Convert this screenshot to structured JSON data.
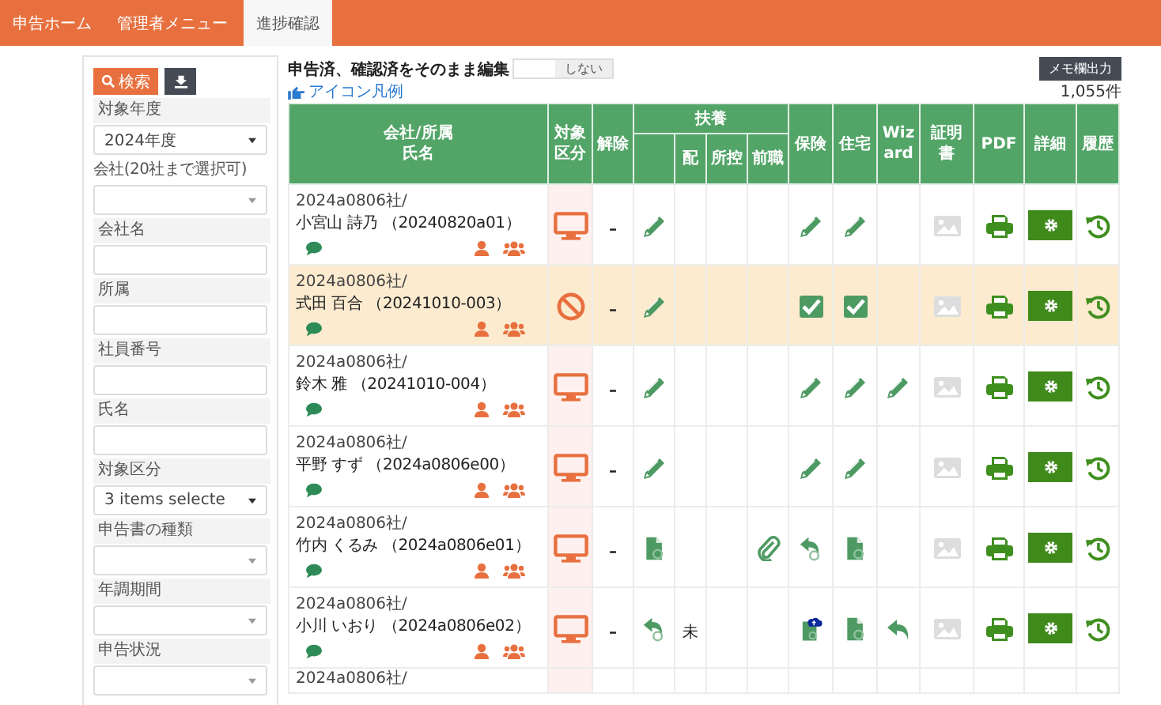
{
  "nav": {
    "tabs": [
      {
        "label": "申告ホーム",
        "selected": false
      },
      {
        "label": "管理者メニュー",
        "selected": false
      },
      {
        "label": "進捗確認",
        "selected": true
      }
    ]
  },
  "sidebar": {
    "search_button": "検索",
    "filters": [
      {
        "label": "対象年度",
        "kind": "select",
        "value": "2024年度"
      },
      {
        "label": "会社(20社まで選択可)",
        "kind": "select",
        "small": true
      },
      {
        "label": "会社名",
        "kind": "input"
      },
      {
        "label": "所属",
        "kind": "input"
      },
      {
        "label": "社員番号",
        "kind": "input"
      },
      {
        "label": "氏名",
        "kind": "input"
      },
      {
        "label": "対象区分",
        "kind": "select",
        "value": "3 items selecte"
      },
      {
        "label": "申告書の種類",
        "kind": "select"
      },
      {
        "label": "年調期間",
        "kind": "select"
      },
      {
        "label": "申告状況",
        "kind": "select"
      }
    ]
  },
  "toolbar": {
    "edit_label": "申告済、確認済をそのまま編集",
    "edit_toggle": {
      "label": "しない",
      "on": false
    },
    "memo_button": "メモ欄出力",
    "legend_link": "アイコン凡例",
    "count": "1,055件"
  },
  "table": {
    "columns": [
      "会社/所属",
      "氏名",
      "対象区分",
      "解除",
      "扶養",
      "配",
      "所控",
      "前職",
      "保険",
      "住宅",
      "Wizard",
      "証明書",
      "PDF",
      "詳細",
      "履歴"
    ],
    "rows": [
      {
        "company": "2024a0806社/",
        "name": "小宮山 詩乃 （20240820a01）",
        "highlighted": false,
        "target": {
          "kind": "pc"
        },
        "release": "–",
        "cells": [
          {
            "kind": "edit"
          },
          {
            "kind": "blank"
          },
          {
            "kind": "blank"
          },
          {
            "kind": "blank"
          },
          {
            "kind": "edit"
          },
          {
            "kind": "edit"
          },
          {
            "kind": "blank"
          }
        ]
      },
      {
        "company": "2024a0806社/",
        "name": "式田 百合 （20241010-003）",
        "highlighted": true,
        "target": {
          "kind": "excluded"
        },
        "release": "–",
        "cells": [
          {
            "kind": "edit"
          },
          {
            "kind": "blank"
          },
          {
            "kind": "blank"
          },
          {
            "kind": "blank"
          },
          {
            "kind": "check"
          },
          {
            "kind": "check"
          },
          {
            "kind": "blank"
          }
        ]
      },
      {
        "company": "2024a0806社/",
        "name": "鈴木 雅 （20241010-004）",
        "highlighted": false,
        "target": {
          "kind": "pc"
        },
        "release": "–",
        "cells": [
          {
            "kind": "edit"
          },
          {
            "kind": "blank"
          },
          {
            "kind": "blank"
          },
          {
            "kind": "blank"
          },
          {
            "kind": "edit"
          },
          {
            "kind": "edit"
          },
          {
            "kind": "edit"
          }
        ]
      },
      {
        "company": "2024a0806社/",
        "name": "平野 すず （2024a0806e00）",
        "highlighted": false,
        "target": {
          "kind": "pc"
        },
        "release": "–",
        "cells": [
          {
            "kind": "edit"
          },
          {
            "kind": "blank"
          },
          {
            "kind": "blank"
          },
          {
            "kind": "blank"
          },
          {
            "kind": "edit"
          },
          {
            "kind": "edit"
          },
          {
            "kind": "blank"
          }
        ]
      },
      {
        "company": "2024a0806社/",
        "name": "竹内 くるみ （2024a0806e01）",
        "highlighted": false,
        "target": {
          "kind": "pc"
        },
        "release": "–",
        "cells": [
          {
            "kind": "doc"
          },
          {
            "kind": "blank"
          },
          {
            "kind": "blank"
          },
          {
            "kind": "clip"
          },
          {
            "kind": "reply_clip"
          },
          {
            "kind": "doc"
          },
          {
            "kind": "blank"
          }
        ]
      },
      {
        "company": "2024a0806社/",
        "name": "小川 いおり （2024a0806e02）",
        "highlighted": false,
        "target": {
          "kind": "pc"
        },
        "release": "–",
        "cells": [
          {
            "kind": "reply_clip"
          },
          {
            "kind": "text",
            "text": "未"
          },
          {
            "kind": "blank"
          },
          {
            "kind": "blank"
          },
          {
            "kind": "upload_doc"
          },
          {
            "kind": "doc"
          },
          {
            "kind": "reply"
          }
        ]
      },
      {
        "company": "2024a0806社/"
      }
    ]
  }
}
